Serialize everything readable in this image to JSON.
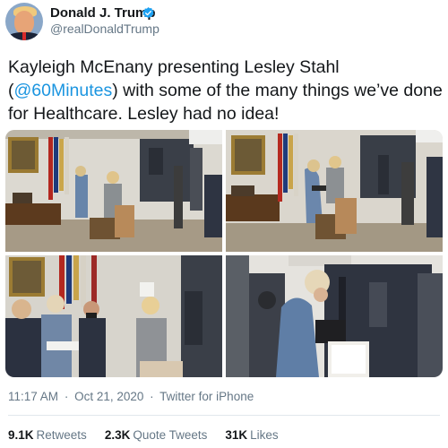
{
  "user": {
    "name": "Donald J. Trump",
    "handle": "@realDonaldTrump"
  },
  "tweet": {
    "text_before": "Kayleigh McEnany presenting Lesley Stahl (",
    "mention": "@60Minutes",
    "text_after": ") with some of the many things we’ve done for Healthcare. Lesley had no idea!"
  },
  "media": {
    "photos": [
      "photo-1",
      "photo-2",
      "photo-3",
      "photo-4"
    ]
  },
  "meta": {
    "time": "11:17 AM",
    "separator1": "·",
    "date": "Oct 21, 2020",
    "separator2": "·",
    "source": "Twitter for iPhone"
  },
  "stats": {
    "retweets_count": "9.1K",
    "retweets_label": "Retweets",
    "quote_count": "2.3K",
    "quote_label": "Quote Tweets",
    "likes_count": "31K",
    "likes_label": "Likes"
  },
  "icons": {
    "verified": "verified-badge-icon",
    "more": "chevron-down-icon"
  },
  "colors": {
    "accent": "#1b95e0",
    "text": "#14171a",
    "secondary": "#657786"
  }
}
